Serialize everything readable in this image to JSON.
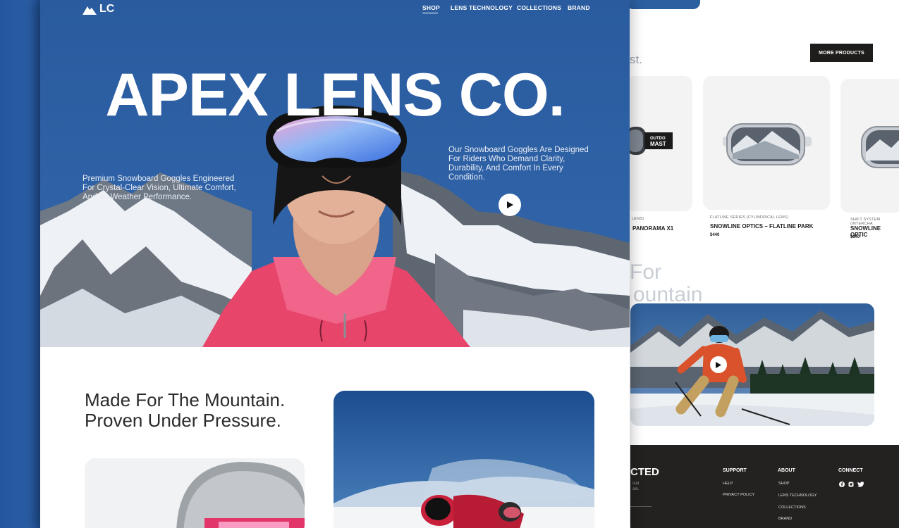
{
  "brand": {
    "logo_text": "LC"
  },
  "nav": {
    "items": [
      {
        "label": "SHOP",
        "active": true
      },
      {
        "label": "LENS TECHNOLOGY",
        "active": false
      },
      {
        "label": "COLLECTIONS",
        "active": false
      },
      {
        "label": "BRAND",
        "active": false
      }
    ]
  },
  "hero": {
    "title": "APEX LENS CO.",
    "left_text": "Premium Snowboard Goggles Engineered For Crystal-Clear Vision, Ultimate Comfort, And All-Weather Performance.",
    "right_text": "Our Snowboard Goggles Are Designed For Riders Who Demand Clarity, Durability, And Comfort In Every Condition."
  },
  "section": {
    "title_line1": "Made For The Mountain.",
    "title_line2": "Proven Under Pressure."
  },
  "products_panel": {
    "heading_fragment": "st.",
    "more_button": "MORE PRODUCTS",
    "products": [
      {
        "series": "LENS)",
        "name": "PANORAMA X1",
        "price": ""
      },
      {
        "series": "FLATLINE SERIES (CYLINDRICAL LENS)",
        "name": "SNOWLINE OPTICS – FLATLINE PARK",
        "price": "$440"
      },
      {
        "series": "SHIFT SYSTEM (INTERCHA",
        "name": "SNOWLINE OPTIC",
        "price": "$340"
      }
    ],
    "goggle_strap_text": "OUTDO MAST"
  },
  "mountain_panel": {
    "line1": "For",
    "line2": "ountain"
  },
  "footer": {
    "brand_fragment": "CTED",
    "tagline_fragment_1": "cial",
    "tagline_fragment_2": "ain.",
    "support": {
      "heading": "SUPPORT",
      "links": [
        "HELP",
        "PRIVACY POLICY"
      ]
    },
    "about": {
      "heading": "ABOUT",
      "links": [
        "SHOP",
        "LENS TECHNOLOGY",
        "COLLECTIONS",
        "BRAND"
      ]
    },
    "connect": {
      "heading": "CONNECT",
      "icons": [
        "facebook-icon",
        "instagram-icon",
        "twitter-icon"
      ]
    }
  },
  "colors": {
    "brand_blue": "#2c5fa3",
    "dark": "#242121",
    "jacket": "#e8456a"
  }
}
